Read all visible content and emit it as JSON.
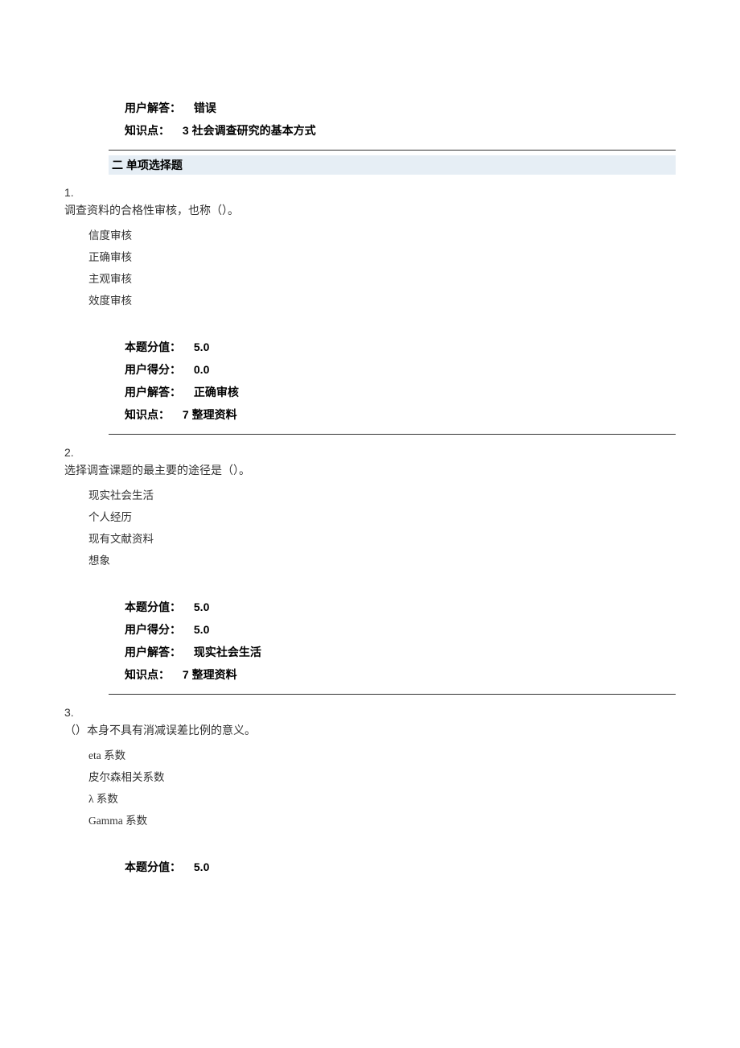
{
  "top_meta": {
    "user_answer_label": "用户解答：",
    "user_answer_value": "错误",
    "knowledge_label": "知识点：",
    "knowledge_value": "3 社会调查研究的基本方式"
  },
  "section": {
    "title": "二 单项选择题"
  },
  "questions": [
    {
      "number": "1.",
      "stem": "调查资料的合格性审核，也称（）。",
      "options": [
        "信度审核",
        "正确审核",
        "主观审核",
        "效度审核"
      ],
      "meta": {
        "score_label": "本题分值：",
        "score_value": "5.0",
        "user_score_label": "用户得分：",
        "user_score_value": "0.0",
        "user_answer_label": "用户解答：",
        "user_answer_value": "正确审核",
        "knowledge_label": "知识点：",
        "knowledge_value": "7 整理资料"
      }
    },
    {
      "number": "2.",
      "stem": "选择调查课题的最主要的途径是（）。",
      "options": [
        "现实社会生活",
        "个人经历",
        "现有文献资料",
        "想象"
      ],
      "meta": {
        "score_label": "本题分值：",
        "score_value": "5.0",
        "user_score_label": "用户得分：",
        "user_score_value": "5.0",
        "user_answer_label": "用户解答：",
        "user_answer_value": "现实社会生活",
        "knowledge_label": "知识点：",
        "knowledge_value": "7 整理资料"
      }
    },
    {
      "number": "3.",
      "stem": "（）本身不具有消减误差比例的意义。",
      "options": [
        "eta 系数",
        "皮尔森相关系数",
        "λ 系数",
        "Gamma 系数"
      ],
      "meta": {
        "score_label": "本题分值：",
        "score_value": "5.0"
      }
    }
  ]
}
